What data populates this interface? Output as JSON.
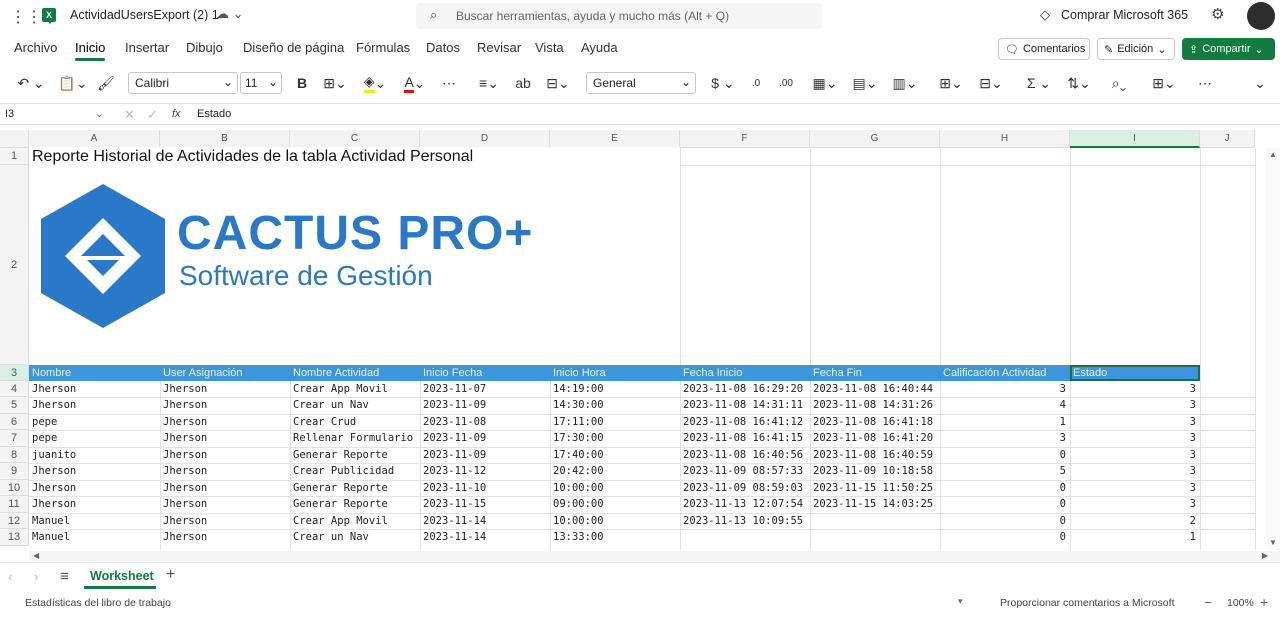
{
  "titlebar": {
    "doc_title": "ActividadUsersExport (2) 1",
    "search_placeholder": "Buscar herramientas, ayuda y mucho más (Alt + Q)",
    "buy_label": "Comprar Microsoft 365"
  },
  "menu": [
    "Archivo",
    "Inicio",
    "Insertar",
    "Dibujo",
    "Diseño de página",
    "Fórmulas",
    "Datos",
    "Revisar",
    "Vista",
    "Ayuda"
  ],
  "menu_active": "Inicio",
  "actions": {
    "comments": "Comentarios",
    "edit": "Edición",
    "share": "Compartir"
  },
  "toolbar": {
    "font": "Calibri",
    "size": "11",
    "number_format": "General"
  },
  "formula_bar": {
    "cell_ref": "I3",
    "fx": "fx",
    "content": "Estado"
  },
  "columns": [
    "A",
    "B",
    "C",
    "D",
    "E",
    "F",
    "G",
    "H",
    "I",
    "J"
  ],
  "title": "Reporte Historial de Actividades de la tabla Actividad  Personal",
  "logo": {
    "brand": "CACTUS PRO+",
    "tagline": "Software de Gestión"
  },
  "headers": [
    "Nombre",
    "User Asignación",
    "Nombre Actividad",
    "Inicio Fecha",
    "Inicio Hora",
    "Fecha Inicio",
    "Fecha Fin",
    "Calificación Actividad",
    "Estado"
  ],
  "rows": [
    [
      "Jherson",
      "Jherson",
      "Crear App Movil",
      "2023-11-07",
      "14:19:00",
      "2023-11-08 16:29:20",
      "2023-11-08 16:40:44",
      "3",
      "3"
    ],
    [
      "Jherson",
      "Jherson",
      "Crear un Nav",
      "2023-11-09",
      "14:30:00",
      "2023-11-08 14:31:11",
      "2023-11-08 14:31:26",
      "4",
      "3"
    ],
    [
      "pepe",
      "Jherson",
      "Crear Crud",
      "2023-11-08",
      "17:11:00",
      "2023-11-08 16:41:12",
      "2023-11-08 16:41:18",
      "1",
      "3"
    ],
    [
      "pepe",
      "Jherson",
      "Rellenar Formulario",
      "2023-11-09",
      "17:30:00",
      "2023-11-08 16:41:15",
      "2023-11-08 16:41:20",
      "3",
      "3"
    ],
    [
      "juanito",
      "Jherson",
      "Generar Reporte",
      "2023-11-09",
      "17:40:00",
      "2023-11-08 16:40:56",
      "2023-11-08 16:40:59",
      "0",
      "3"
    ],
    [
      "Jherson",
      "Jherson",
      "Crear Publicidad",
      "2023-11-12",
      "20:42:00",
      "2023-11-09 08:57:33",
      "2023-11-09 10:18:58",
      "5",
      "3"
    ],
    [
      "Jherson",
      "Jherson",
      "Generar Reporte",
      "2023-11-10",
      "10:00:00",
      "2023-11-09 08:59:03",
      "2023-11-15 11:50:25",
      "0",
      "3"
    ],
    [
      "Jherson",
      "Jherson",
      "Generar Reporte",
      "2023-11-15",
      "09:00:00",
      "2023-11-13 12:07:54",
      "2023-11-15 14:03:25",
      "0",
      "3"
    ],
    [
      "Manuel",
      "Jherson",
      "Crear App Movil",
      "2023-11-14",
      "10:00:00",
      "2023-11-13 10:09:55",
      "",
      "0",
      "2"
    ],
    [
      "Manuel",
      "Jherson",
      "Crear un Nav",
      "2023-11-14",
      "13:33:00",
      "",
      "",
      "0",
      "1"
    ]
  ],
  "row_numbers": [
    "1",
    "2",
    "3",
    "4",
    "5",
    "6",
    "7",
    "8",
    "9",
    "10",
    "11",
    "12",
    "13"
  ],
  "sheet_tab": "Worksheet",
  "status": {
    "left": "Estadísticas del libro de trabajo",
    "feedback": "Proporcionar comentarios a Microsoft",
    "zoom": "100%"
  },
  "colors": {
    "accent": "#107c41",
    "header_fill": "#3d96dc",
    "logo_blue": "#2a78c8"
  }
}
